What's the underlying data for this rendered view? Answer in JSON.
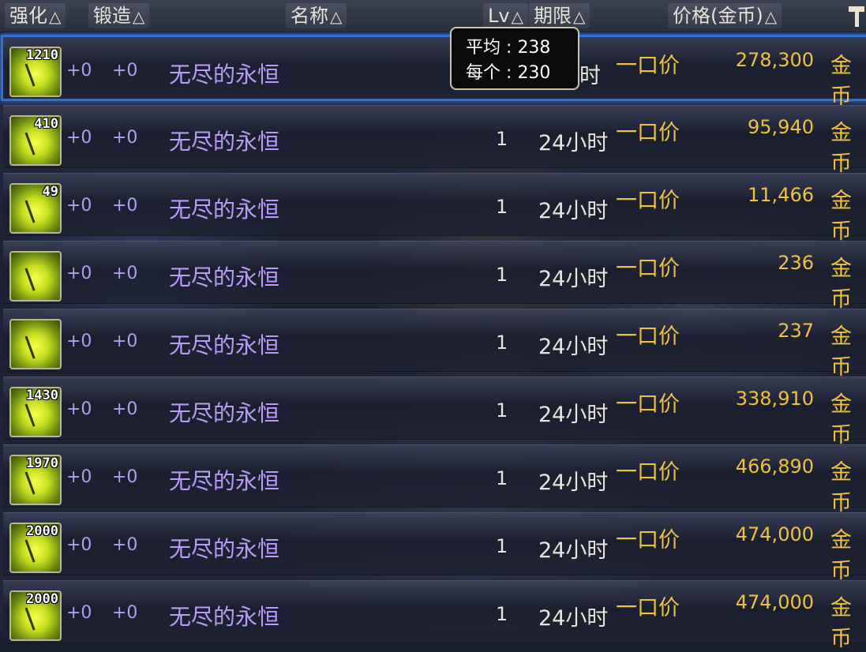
{
  "header": {
    "enhance": "强化",
    "forge": "锻造",
    "name": "名称",
    "lv": "Lv",
    "period": "期限",
    "price": "价格(金币)",
    "sort_mark": "△"
  },
  "tooltip": {
    "avg_label": "平均",
    "avg_value": "238",
    "each_label": "每个",
    "each_value": "230",
    "sep": ":"
  },
  "rows": [
    {
      "qty": "1210",
      "enhance": "+0",
      "forge": "+0",
      "name": "无尽的永恒",
      "lv": "",
      "period": "时",
      "type": "一口价",
      "price": "278,300",
      "currency": "金币"
    },
    {
      "qty": "410",
      "enhance": "+0",
      "forge": "+0",
      "name": "无尽的永恒",
      "lv": "1",
      "period": "24小时",
      "type": "一口价",
      "price": "95,940",
      "currency": "金币"
    },
    {
      "qty": "49",
      "enhance": "+0",
      "forge": "+0",
      "name": "无尽的永恒",
      "lv": "1",
      "period": "24小时",
      "type": "一口价",
      "price": "11,466",
      "currency": "金币"
    },
    {
      "qty": "",
      "enhance": "+0",
      "forge": "+0",
      "name": "无尽的永恒",
      "lv": "1",
      "period": "24小时",
      "type": "一口价",
      "price": "236",
      "currency": "金币"
    },
    {
      "qty": "",
      "enhance": "+0",
      "forge": "+0",
      "name": "无尽的永恒",
      "lv": "1",
      "period": "24小时",
      "type": "一口价",
      "price": "237",
      "currency": "金币"
    },
    {
      "qty": "1430",
      "enhance": "+0",
      "forge": "+0",
      "name": "无尽的永恒",
      "lv": "1",
      "period": "24小时",
      "type": "一口价",
      "price": "338,910",
      "currency": "金币"
    },
    {
      "qty": "1970",
      "enhance": "+0",
      "forge": "+0",
      "name": "无尽的永恒",
      "lv": "1",
      "period": "24小时",
      "type": "一口价",
      "price": "466,890",
      "currency": "金币"
    },
    {
      "qty": "2000",
      "enhance": "+0",
      "forge": "+0",
      "name": "无尽的永恒",
      "lv": "1",
      "period": "24小时",
      "type": "一口价",
      "price": "474,000",
      "currency": "金币"
    },
    {
      "qty": "2000",
      "enhance": "+0",
      "forge": "+0",
      "name": "无尽的永恒",
      "lv": "1",
      "period": "24小时",
      "type": "一口价",
      "price": "474,000",
      "currency": "金币"
    }
  ],
  "colors": {
    "name": "#b89cf8",
    "gold": "#f0c040",
    "selection": "#2f6fd6"
  }
}
